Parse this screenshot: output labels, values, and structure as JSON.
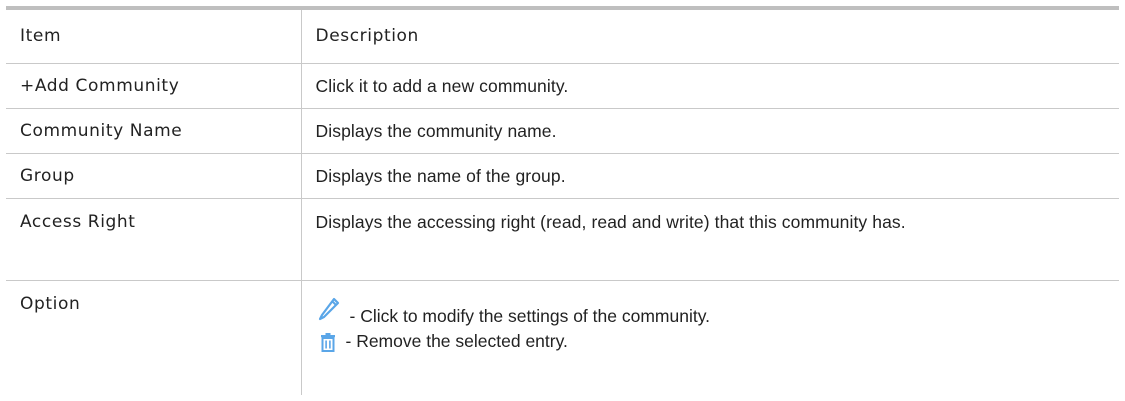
{
  "header": {
    "item": "Item",
    "description": "Description"
  },
  "rows": [
    {
      "item": "+Add Community",
      "description": "Click it to add a new community."
    },
    {
      "item": "Community Name",
      "description": "Displays the community name."
    },
    {
      "item": "Group",
      "description": "Displays the name of the group."
    },
    {
      "item": "Access Right",
      "description": "Displays the accessing right (read, read and write) that this community has."
    }
  ],
  "option": {
    "item": "Option",
    "entries": [
      {
        "icon": "pencil-icon",
        "text": "- Click to modify the settings of the community."
      },
      {
        "icon": "trash-icon",
        "text": "- Remove the selected entry."
      }
    ]
  },
  "colors": {
    "icon_blue": "#5aa6e8",
    "rule_gray": "#bfbfbf",
    "border_gray": "#c9c9c9"
  }
}
